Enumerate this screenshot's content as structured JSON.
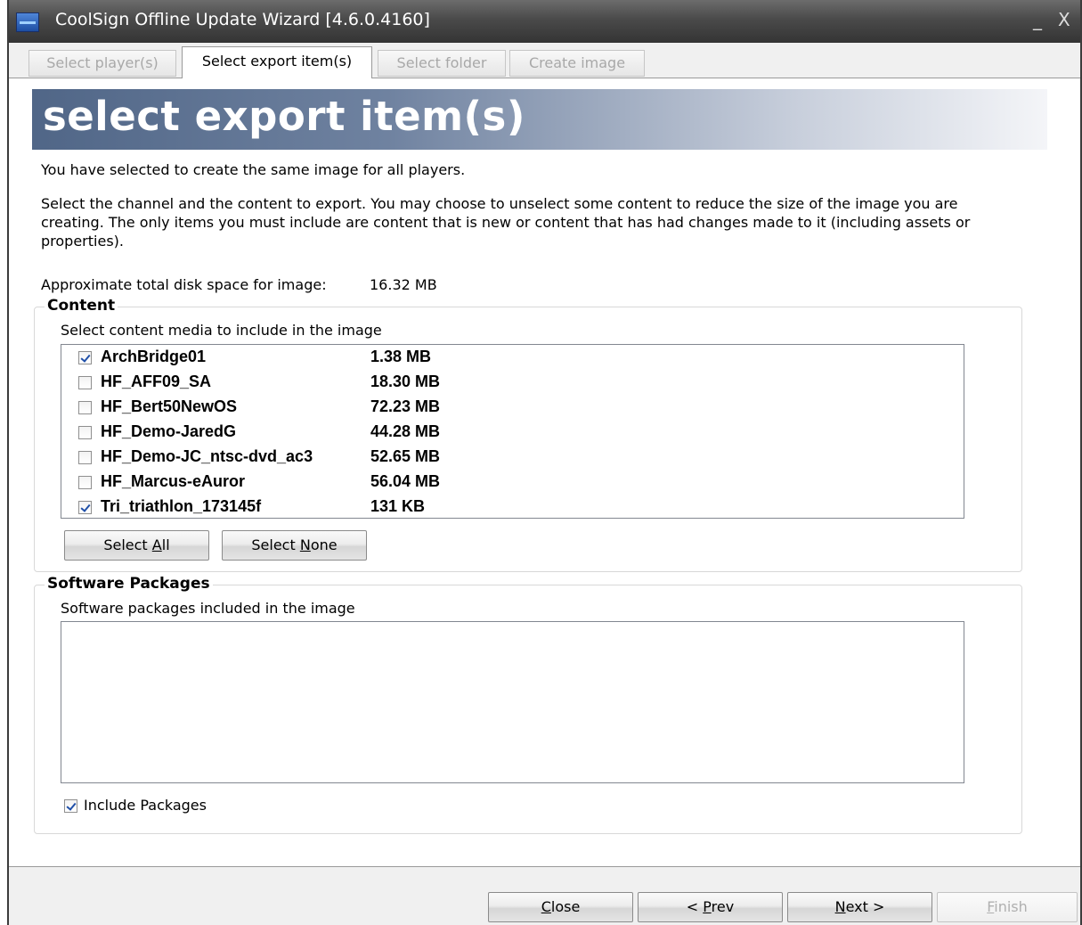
{
  "window": {
    "title": "CoolSign Offline Update Wizard [4.6.0.4160]",
    "minimize_glyph": "_",
    "close_glyph": "X"
  },
  "tabs": [
    {
      "label": "Select player(s)",
      "state": "disabled"
    },
    {
      "label": "Select export item(s)",
      "state": "active"
    },
    {
      "label": "Select folder",
      "state": "disabled"
    },
    {
      "label": "Create image",
      "state": "disabled"
    }
  ],
  "page": {
    "heading": "select export item(s)",
    "info_line": "You have selected to create the same image for all players.",
    "description": "Select the channel and the content to export.  You may choose to unselect some content to reduce the size of the image you are creating.  The only items you must include are content that is new or content that has had changes made to it (including assets or properties).",
    "disk_space_label": "Approximate total disk space for image:",
    "disk_space_value": "16.32 MB"
  },
  "content_group": {
    "title": "Content",
    "instruction": "Select content media to include in the image",
    "items": [
      {
        "name": "ArchBridge01",
        "size": "1.38 MB",
        "checked": true
      },
      {
        "name": "HF_AFF09_SA",
        "size": "18.30 MB",
        "checked": false
      },
      {
        "name": "HF_Bert50NewOS",
        "size": "72.23 MB",
        "checked": false
      },
      {
        "name": "HF_Demo-JaredG",
        "size": "44.28 MB",
        "checked": false
      },
      {
        "name": "HF_Demo-JC_ntsc-dvd_ac3",
        "size": "52.65 MB",
        "checked": false
      },
      {
        "name": "HF_Marcus-eAuror",
        "size": "56.04 MB",
        "checked": false
      },
      {
        "name": "Tri_triathlon_173145f",
        "size": "131 KB",
        "checked": true
      }
    ],
    "select_all": {
      "pre": "Select ",
      "key": "A",
      "post": "ll"
    },
    "select_none": {
      "pre": "Select ",
      "key": "N",
      "post": "one"
    }
  },
  "software_group": {
    "title": "Software Packages",
    "instruction": "Software packages included in the image",
    "include_packages_label": "Include Packages",
    "include_packages_checked": true
  },
  "footer": {
    "close": {
      "key": "C",
      "post": "lose"
    },
    "prev": {
      "pre": "< ",
      "key": "P",
      "post": "rev"
    },
    "next": {
      "key": "N",
      "post": "ext >"
    },
    "finish": {
      "key": "F",
      "post": "inish",
      "disabled": true
    }
  },
  "colors": {
    "banner_start": "#506687",
    "banner_end": "#f4f5f8",
    "titlebar": "#4a4a4a",
    "check_mark": "#1f4fa8"
  }
}
